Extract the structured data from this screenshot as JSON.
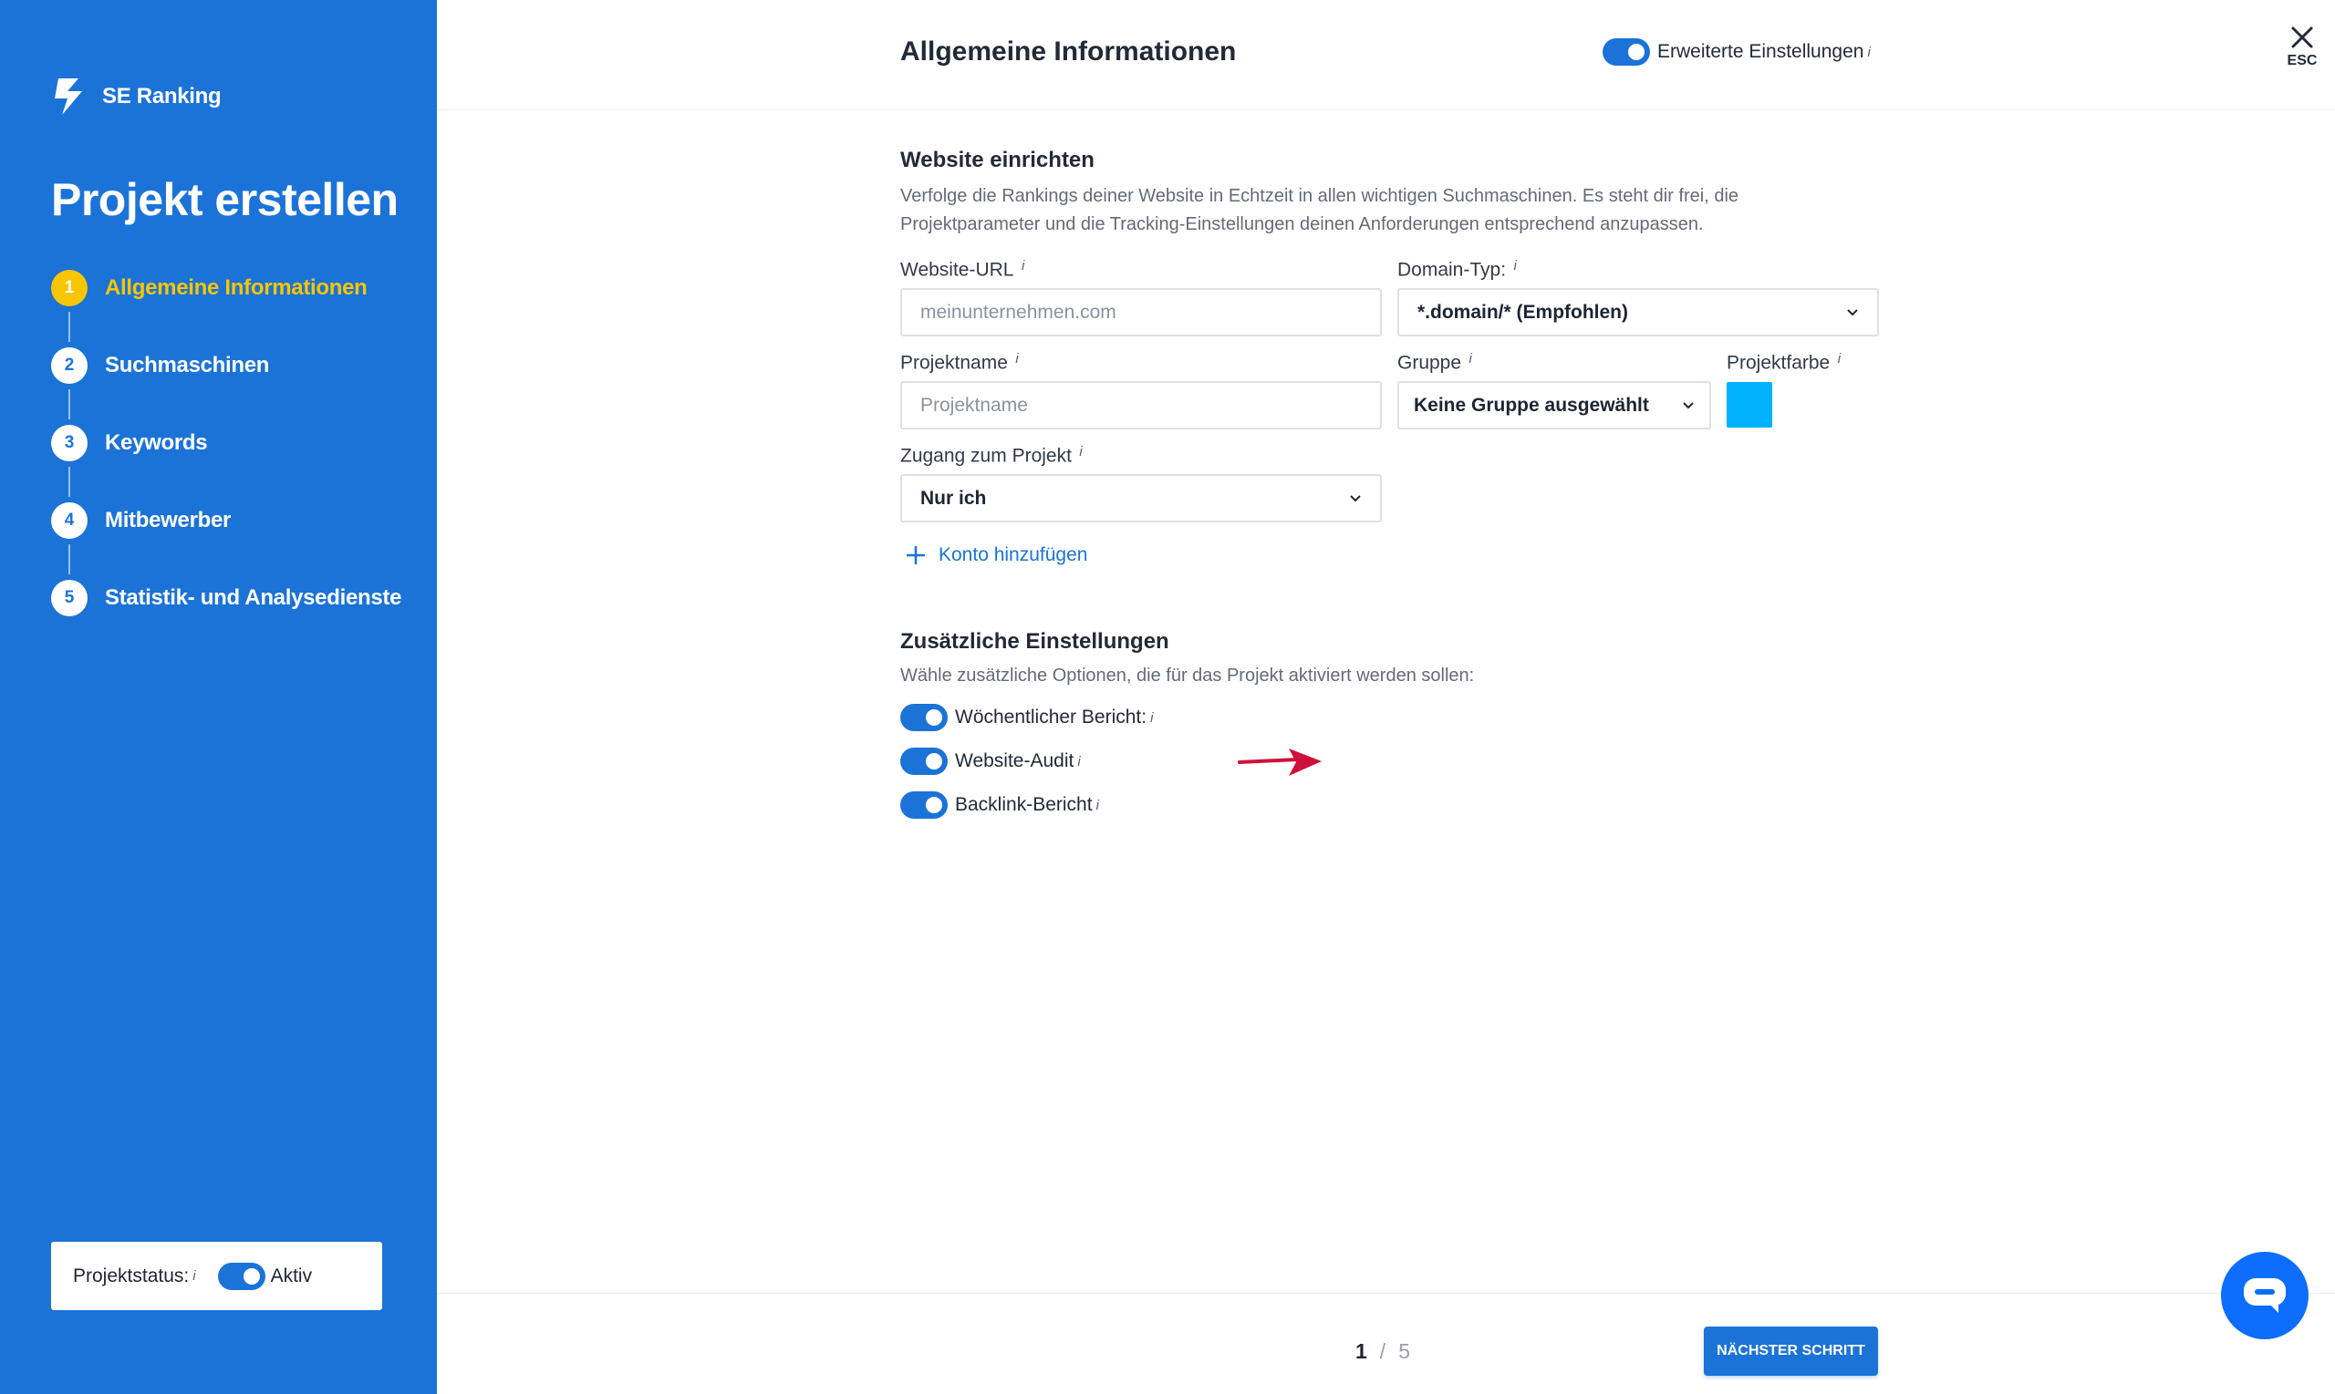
{
  "brand": {
    "name": "SE Ranking"
  },
  "sidebar": {
    "title": "Projekt erstellen",
    "steps": [
      {
        "num": "1",
        "label": "Allgemeine Informationen",
        "active": true
      },
      {
        "num": "2",
        "label": "Suchmaschinen"
      },
      {
        "num": "3",
        "label": "Keywords"
      },
      {
        "num": "4",
        "label": "Mitbewerber"
      },
      {
        "num": "5",
        "label": "Statistik- und Analysedienste"
      }
    ],
    "status": {
      "label": "Projektstatus:",
      "info": "i",
      "value": "Aktiv",
      "toggle_on": true
    }
  },
  "header": {
    "title": "Allgemeine Informationen",
    "advanced_settings": {
      "label": "Erweiterte Einstellungen",
      "info": "i",
      "toggle_on": true
    },
    "close_label": "ESC"
  },
  "website": {
    "title": "Website einrichten",
    "description": "Verfolge die Rankings deiner Website in Echtzeit in allen wichtigen Suchmaschinen. Es steht dir frei, die Projektparameter und die Tracking-Einstellungen deinen Anforderungen entsprechend anzupassen.",
    "url": {
      "label": "Website-URL",
      "info": "i",
      "placeholder": "meinunternehmen.com",
      "value": ""
    },
    "domain_type": {
      "label": "Domain-Typ:",
      "info": "i",
      "value": "*.domain/* (Empfohlen)"
    },
    "project_name": {
      "label": "Projektname",
      "info": "i",
      "placeholder": "Projektname",
      "value": ""
    },
    "group": {
      "label": "Gruppe",
      "info": "i",
      "value": "Keine Gruppe ausgewählt"
    },
    "project_color": {
      "label": "Projektfarbe",
      "info": "i",
      "value": "#00b2ff"
    },
    "access": {
      "label": "Zugang zum Projekt",
      "info": "i",
      "value": "Nur ich"
    },
    "add_account": "Konto hinzufügen"
  },
  "additional": {
    "title": "Zusätzliche Einstellungen",
    "description": "Wähle zusätzliche Optionen, die für das Projekt aktiviert werden sollen:",
    "options": [
      {
        "label": "Wöchentlicher Bericht:",
        "info": "i",
        "on": true
      },
      {
        "label": "Website-Audit",
        "info": "i",
        "on": true
      },
      {
        "label": "Backlink-Bericht",
        "info": "i",
        "on": true
      }
    ]
  },
  "footer": {
    "pager": {
      "current": "1",
      "separator": "/",
      "total": "5"
    },
    "next_button": "NÄCHSTER SCHRITT"
  },
  "colors": {
    "sidebar": "#1b73d8",
    "active_step": "#f7c600",
    "accent": "#1b73d8",
    "annotation_arrow": "#d0103a"
  }
}
